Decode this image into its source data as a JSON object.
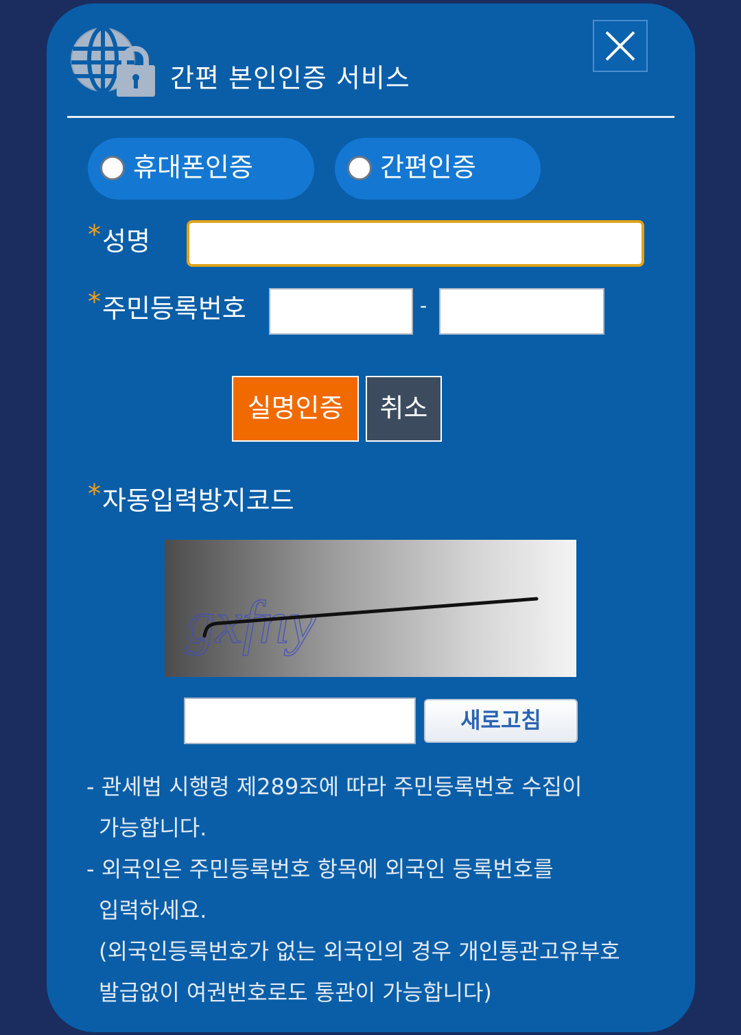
{
  "header": {
    "title": "간편 본인인증 서비스",
    "close_label": "X"
  },
  "auth_methods": [
    {
      "label": "휴대폰인증",
      "selected": false
    },
    {
      "label": "간편인증",
      "selected": false
    }
  ],
  "form": {
    "required_mark": "*",
    "name_label": "성명",
    "name_value": "",
    "rrn_label": "주민등록번호",
    "rrn_front_value": "",
    "rrn_back_value": "",
    "rrn_separator": "-"
  },
  "buttons": {
    "verify_label": "실명인증",
    "cancel_label": "취소"
  },
  "captcha": {
    "label": "자동입력방지코드",
    "code_text": "gxfny",
    "input_value": "",
    "refresh_label": "새로고침"
  },
  "notes": [
    "- 관세법 시행령 제289조에 따라 주민등록번호 수집이",
    "가능합니다.",
    "- 외국인은 주민등록번호 항목에 외국인 등록번호를",
    "입력하세요.",
    "(외국인등록번호가 없는 외국인의 경우 개인통관고유부호",
    "발급없이 여권번호로도 통관이 가능합니다)"
  ],
  "colors": {
    "modal_bg": "#0a5ea8",
    "page_bg": "#1a2d5e",
    "accent_orange": "#f06a00",
    "asterisk": "#f4a019",
    "focus_border": "#e0a21a"
  }
}
